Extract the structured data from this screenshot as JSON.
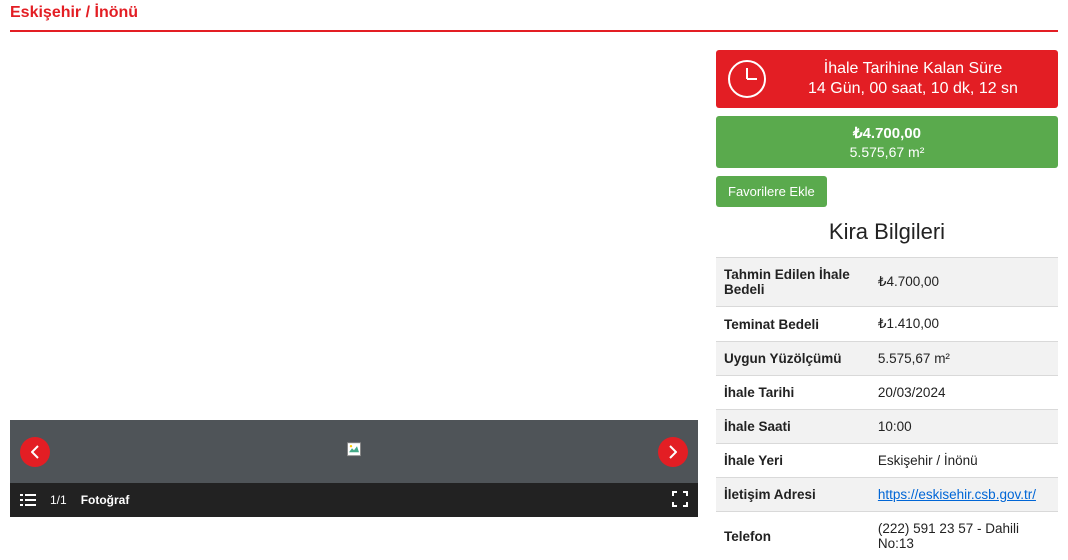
{
  "breadcrumb": "Eskişehir / İnönü",
  "countdown": {
    "title": "İhale Tarihine Kalan Süre",
    "value": "14 Gün, 00 saat, 10 dk, 12 sn"
  },
  "summary": {
    "price": "₺4.700,00",
    "area": "5.575,67 m²"
  },
  "favorites_button": "Favorilere Ekle",
  "section_title": "Kira Bilgileri",
  "rows": [
    {
      "label": "Tahmin Edilen İhale Bedeli",
      "value": "₺4.700,00"
    },
    {
      "label": "Teminat Bedeli",
      "value": "₺1.410,00"
    },
    {
      "label": "Uygun Yüzölçümü",
      "value": "5.575,67 m²"
    },
    {
      "label": "İhale Tarihi",
      "value": "20/03/2024"
    },
    {
      "label": "İhale Saati",
      "value": "10:00"
    },
    {
      "label": "İhale Yeri",
      "value": "Eskişehir / İnönü"
    },
    {
      "label": "İletişim Adresi",
      "value": "https://eskisehir.csb.gov.tr/",
      "is_link": true
    },
    {
      "label": "Telefon",
      "value": "(222) 591 23 57 - Dahili No:13"
    }
  ],
  "gallery": {
    "counter": "1/1",
    "label": "Fotoğraf"
  }
}
